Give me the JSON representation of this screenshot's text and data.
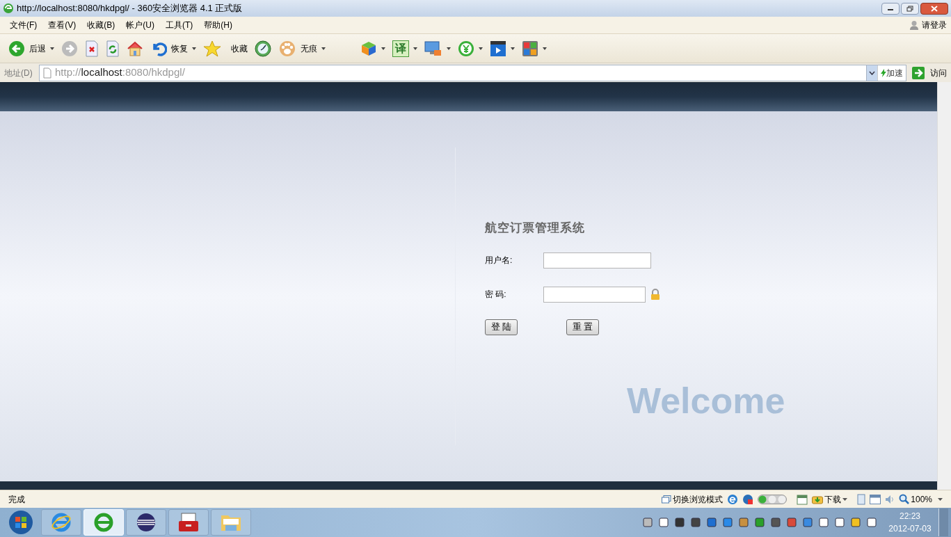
{
  "window": {
    "title": "http://localhost:8080/hkdpgl/ - 360安全浏览器 4.1 正式版"
  },
  "menu": [
    "文件(F)",
    "查看(V)",
    "收藏(B)",
    "帐户(U)",
    "工具(T)",
    "帮助(H)"
  ],
  "account": {
    "label": "请登录"
  },
  "toolbar": [
    {
      "kind": "back",
      "label": "后退",
      "dropdown": true
    },
    {
      "kind": "forward",
      "dropdown": false
    },
    {
      "kind": "stop",
      "dropdown": false
    },
    {
      "kind": "refresh",
      "dropdown": false
    },
    {
      "kind": "home",
      "dropdown": false
    },
    {
      "kind": "undo",
      "label": "恢复",
      "dropdown": true
    },
    {
      "kind": "star",
      "label": "收藏",
      "dropdown": false
    },
    {
      "kind": "clock",
      "dropdown": false
    },
    {
      "kind": "paw",
      "label": "无痕",
      "dropdown": true
    },
    {
      "kind": "gap"
    },
    {
      "kind": "cube",
      "dropdown": true
    },
    {
      "kind": "translate",
      "glyph": "译",
      "dropdown": true
    },
    {
      "kind": "monitor",
      "dropdown": true
    },
    {
      "kind": "coin",
      "dropdown": true
    },
    {
      "kind": "video",
      "dropdown": true
    },
    {
      "kind": "apps",
      "dropdown": true
    }
  ],
  "address": {
    "label": "地址(D)",
    "scheme": "http://",
    "host": "localhost",
    "rest": ":8080/hkdpgl/",
    "speed": "加速",
    "go": "访问"
  },
  "login": {
    "title": "航空订票管理系统",
    "fields": [
      {
        "label": "用户名:",
        "kind": "text"
      },
      {
        "label": "密 码:",
        "kind": "password"
      }
    ],
    "buttons": [
      "登 陆",
      "重 置"
    ],
    "background_text": "Welcome"
  },
  "status_bar": {
    "text": "完成",
    "mode": "切换浏览模式",
    "download": "下载",
    "zoom": "100%"
  },
  "taskbar": {
    "apps": [
      {
        "kind": "ie",
        "selected": false
      },
      {
        "kind": "browser",
        "selected": true
      },
      {
        "kind": "eclipse",
        "selected": false
      },
      {
        "kind": "toolbox",
        "selected": false
      },
      {
        "kind": "folder",
        "selected": false
      }
    ],
    "time": "22:23",
    "date": "2012-07-03"
  }
}
